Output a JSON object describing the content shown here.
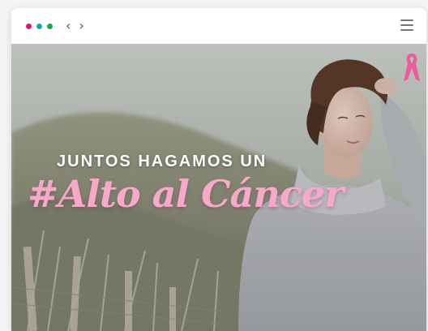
{
  "browser": {
    "dots": [
      {
        "color": "#e0156b"
      },
      {
        "color": "#1aa3b5"
      },
      {
        "color": "#18a45b"
      }
    ],
    "back_icon": "‹",
    "forward_icon": "›",
    "menu_icon": "hamburger-icon"
  },
  "hero": {
    "headline": "JUNTOS HAGAMOS UN",
    "hashtag": "#Alto al Cáncer",
    "ribbon_icon": "pink-ribbon-icon",
    "colors": {
      "headline": "#ffffff",
      "hashtag": "#f6a9c9",
      "ribbon": "#ea5d9b"
    }
  }
}
